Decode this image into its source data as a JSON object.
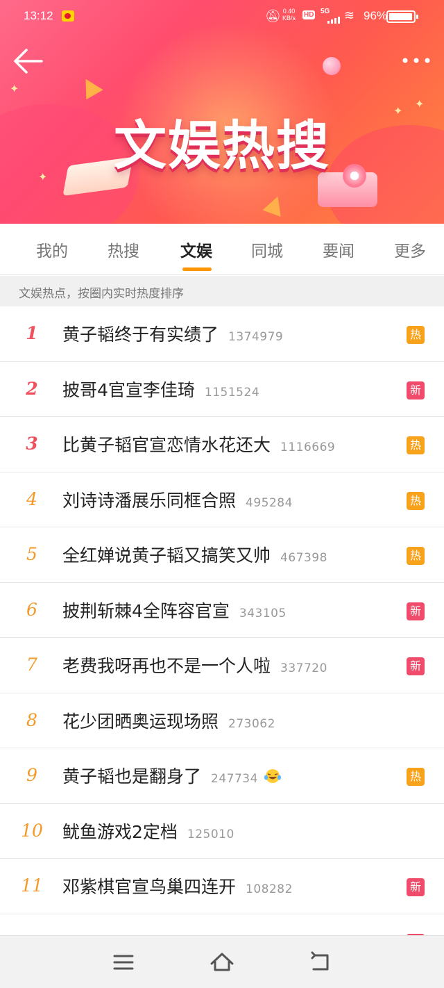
{
  "status_bar": {
    "time": "13:12",
    "net_speed_value": "0.40",
    "net_speed_unit": "KB/s",
    "hd": "HD",
    "network": "5G",
    "battery": "96%"
  },
  "banner": {
    "title": "文娱热搜"
  },
  "tabs": [
    {
      "label": "我的"
    },
    {
      "label": "热搜"
    },
    {
      "label": "文娱"
    },
    {
      "label": "同城"
    },
    {
      "label": "要闻"
    },
    {
      "label": "更多"
    }
  ],
  "active_tab": "文娱",
  "subheader": "文娱热点，按圈内实时热度排序",
  "colors": {
    "accent": "#ff9500",
    "hot_badge": "#f7a21b",
    "new_badge": "#f04b6a",
    "rank_top": "#f0515e",
    "rank_other": "#f39a29"
  },
  "list": [
    {
      "rank": "1",
      "title": "黄子韬终于有实绩了",
      "count": "1374979",
      "badge": "热"
    },
    {
      "rank": "2",
      "title": "披哥4官宣李佳琦",
      "count": "1151524",
      "badge": "新"
    },
    {
      "rank": "3",
      "title": "比黄子韬官宣恋情水花还大",
      "count": "1116669",
      "badge": "热"
    },
    {
      "rank": "4",
      "title": "刘诗诗潘展乐同框合照",
      "count": "495284",
      "badge": "热"
    },
    {
      "rank": "5",
      "title": "全红婵说黄子韬又搞笑又帅",
      "count": "467398",
      "badge": "热"
    },
    {
      "rank": "6",
      "title": "披荆斩棘4全阵容官宣",
      "count": "343105",
      "badge": "新"
    },
    {
      "rank": "7",
      "title": "老费我呀再也不是一个人啦",
      "count": "337720",
      "badge": "新"
    },
    {
      "rank": "8",
      "title": "花少团晒奥运现场照",
      "count": "273062",
      "badge": ""
    },
    {
      "rank": "9",
      "title": "黄子韬也是翻身了",
      "count": "247734",
      "badge": "热",
      "emoji": "crying-laughing-emoji"
    },
    {
      "rank": "10",
      "title": "鱿鱼游戏2定档",
      "count": "125010",
      "badge": ""
    },
    {
      "rank": "11",
      "title": "邓紫棋官宣鸟巢四连开",
      "count": "108282",
      "badge": "新"
    }
  ]
}
